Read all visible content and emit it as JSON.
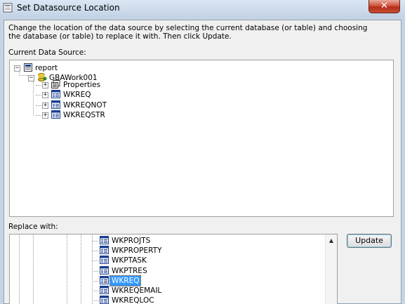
{
  "window": {
    "title": "Set Datasource Location",
    "close_glyph": "✕"
  },
  "instructions": "Change the location of the data source by selecting the current database (or table) and choosing the database (or table) to replace it with.  Then click Update.",
  "current_source": {
    "label": "Current Data Source:",
    "root": "report",
    "db": "GBAWork001",
    "items": [
      "Properties",
      "WKREQ",
      "WKREQNOT",
      "WKREQSTR"
    ]
  },
  "replace": {
    "label": "Replace with:",
    "items": [
      "WKPROJTS",
      "WKPROPERTY",
      "WKPTASK",
      "WKPTRES",
      "WKREQ",
      "WKREQEMAIL",
      "WKREQLOC"
    ],
    "selected": "WKREQ"
  },
  "update_label": "Update",
  "icons": {
    "report": "report-icon",
    "db": "database-icon",
    "properties": "properties-icon",
    "table": "table-icon"
  }
}
